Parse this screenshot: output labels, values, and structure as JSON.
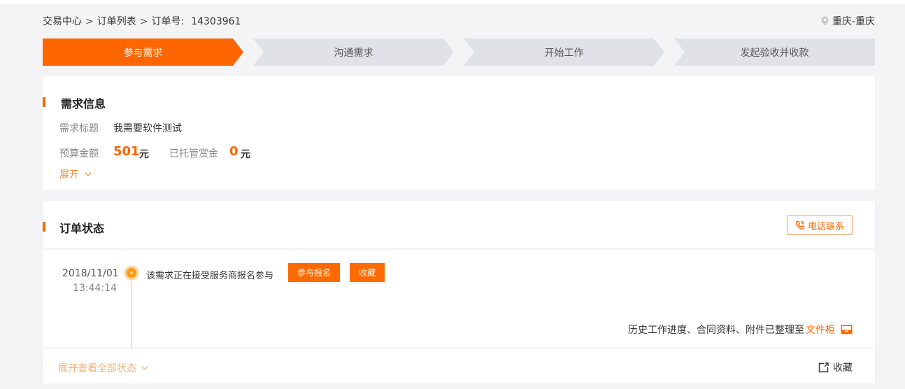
{
  "breadcrumb": {
    "items": [
      "交易中心",
      "订单列表"
    ],
    "separator": ">",
    "order_label": "订单号:",
    "order_number": "14303961"
  },
  "location": {
    "text": "重庆-重庆",
    "icon": "location-pin-icon"
  },
  "steps": [
    {
      "label": "参与需求",
      "active": true
    },
    {
      "label": "沟通需求",
      "active": false
    },
    {
      "label": "开始工作",
      "active": false
    },
    {
      "label": "发起验收并收款",
      "active": false
    }
  ],
  "demand": {
    "title": "需求信息",
    "subject_label": "需求标题",
    "subject_value": "我需要软件测试",
    "budget_label": "预算金额",
    "budget_value": "501",
    "budget_unit": "元",
    "escrow_label": "已托管赏金",
    "escrow_value": "0",
    "escrow_unit": "元",
    "expand_label": "展开"
  },
  "order": {
    "title": "订单状态",
    "phone_button": "电话联系",
    "timeline": {
      "date": "2018/11/01",
      "time": "13:44:14",
      "text": "该需求正在接受服务商报名参与",
      "join_button": "参与报名",
      "fav_button": "收藏"
    },
    "history_text": "历史工作进度、合同资料、附件已整理至",
    "history_link": "文件柜",
    "expand_all": "展开查看全部状态",
    "collect_label": "收藏"
  },
  "colors": {
    "accent": "#ff6600",
    "step_inactive": "#e1e2e8",
    "background": "#f4f4f7"
  }
}
